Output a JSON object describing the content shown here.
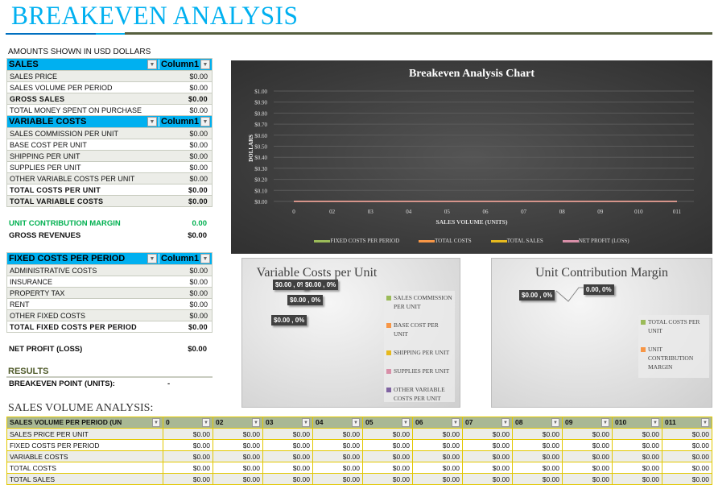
{
  "title": "BREAKEVEN ANALYSIS",
  "amounts_note": "AMOUNTS SHOWN IN USD DOLLARS",
  "column_label": "Column1",
  "sales": {
    "header": "SALES",
    "rows": [
      {
        "label": "SALES PRICE",
        "value": "$0.00",
        "bold": false
      },
      {
        "label": "SALES VOLUME PER PERIOD",
        "value": "$0.00",
        "bold": false
      },
      {
        "label": "GROSS SALES",
        "value": "$0.00",
        "bold": true
      },
      {
        "label": "TOTAL MONEY SPENT ON PURCHASE",
        "value": "$0.00",
        "bold": false
      }
    ]
  },
  "variable": {
    "header": "VARIABLE COSTS",
    "rows": [
      {
        "label": "SALES COMMISSION PER UNIT",
        "value": "$0.00",
        "bold": false
      },
      {
        "label": "BASE COST PER UNIT",
        "value": "$0.00",
        "bold": false
      },
      {
        "label": "SHIPPING PER UNIT",
        "value": "$0.00",
        "bold": false
      },
      {
        "label": "SUPPLIES PER UNIT",
        "value": "$0.00",
        "bold": false
      },
      {
        "label": "OTHER VARIABLE COSTS PER UNIT",
        "value": "$0.00",
        "bold": false
      },
      {
        "label": "TOTAL COSTS PER UNIT",
        "value": "$0.00",
        "bold": true
      },
      {
        "label": "TOTAL VARIABLE COSTS",
        "value": "$0.00",
        "bold": true
      }
    ]
  },
  "ucm": {
    "label": "UNIT CONTRIBUTION MARGIN",
    "value": "0.00"
  },
  "gross_revenues": {
    "label": "GROSS REVENUES",
    "value": "$0.00"
  },
  "fixed": {
    "header": "FIXED COSTS PER PERIOD",
    "rows": [
      {
        "label": "ADMINISTRATIVE COSTS",
        "value": "$0.00",
        "bold": false
      },
      {
        "label": "INSURANCE",
        "value": "$0.00",
        "bold": false
      },
      {
        "label": "PROPERTY TAX",
        "value": "$0.00",
        "bold": false
      },
      {
        "label": "RENT",
        "value": "$0.00",
        "bold": false
      },
      {
        "label": "OTHER FIXED COSTS",
        "value": "$0.00",
        "bold": false
      },
      {
        "label": "TOTAL FIXED COSTS PER PERIOD",
        "value": "$0.00",
        "bold": true
      }
    ]
  },
  "net_profit": {
    "label": "NET PROFIT (LOSS)",
    "value": "$0.00"
  },
  "results": {
    "header": "RESULTS",
    "breakeven_label": "BREAKEVEN POINT (UNITS):",
    "breakeven_value": "-"
  },
  "chart_data": [
    {
      "type": "line",
      "title": "Breakeven Analysis Chart",
      "xlabel": "SALES VOLUME (UNITS)",
      "ylabel": "DOLLARS",
      "categories": [
        "0",
        "02",
        "03",
        "04",
        "05",
        "06",
        "07",
        "08",
        "09",
        "010",
        "011"
      ],
      "yticks": [
        "$0.00",
        "$0.10",
        "$0.20",
        "$0.30",
        "$0.40",
        "$0.50",
        "$0.60",
        "$0.70",
        "$0.80",
        "$0.90",
        "$1.00"
      ],
      "ylim": [
        0,
        1
      ],
      "legend": "bottom",
      "series": [
        {
          "name": "FIXED COSTS PER PERIOD",
          "color": "#9bbb59",
          "values": [
            0,
            0,
            0,
            0,
            0,
            0,
            0,
            0,
            0,
            0,
            0
          ]
        },
        {
          "name": "TOTAL COSTS",
          "color": "#f79646",
          "values": [
            0,
            0,
            0,
            0,
            0,
            0,
            0,
            0,
            0,
            0,
            0
          ]
        },
        {
          "name": "TOTAL SALES",
          "color": "#e6b91e",
          "values": [
            0,
            0,
            0,
            0,
            0,
            0,
            0,
            0,
            0,
            0,
            0
          ]
        },
        {
          "name": "NET PROFIT (LOSS)",
          "color": "#d88fa8",
          "values": [
            0,
            0,
            0,
            0,
            0,
            0,
            0,
            0,
            0,
            0,
            0
          ]
        }
      ]
    },
    {
      "type": "pie",
      "title": "Variable Costs per Unit",
      "legend": "right",
      "data_labels": [
        "$0.00 , 0%",
        "$0.00 , 0%",
        "$0.00 , 0%",
        "$0.00 , 0%"
      ],
      "series": [
        {
          "name": "SALES COMMISSION PER UNIT",
          "color": "#9bbb59",
          "value": 0
        },
        {
          "name": "BASE COST PER UNIT",
          "color": "#f79646",
          "value": 0
        },
        {
          "name": "SHIPPING PER UNIT",
          "color": "#e6b91e",
          "value": 0
        },
        {
          "name": "SUPPLIES PER UNIT",
          "color": "#d88fa8",
          "value": 0
        },
        {
          "name": "OTHER VARIABLE COSTS PER UNIT",
          "color": "#8064a2",
          "value": 0
        }
      ]
    },
    {
      "type": "pie",
      "title": "Unit Contribution Margin",
      "legend": "right",
      "data_labels": [
        "$0.00 , 0%",
        "0.00, 0%"
      ],
      "series": [
        {
          "name": "TOTAL COSTS PER UNIT",
          "color": "#9bbb59",
          "value": 0
        },
        {
          "name": "UNIT CONTRIBUTION MARGIN",
          "color": "#f79646",
          "value": 0
        }
      ]
    }
  ],
  "sva": {
    "title": "SALES VOLUME ANALYSIS:",
    "header": [
      "SALES VOLUME PER PERIOD (UN",
      "0",
      "02",
      "03",
      "04",
      "05",
      "06",
      "07",
      "08",
      "09",
      "010",
      "011"
    ],
    "rows": [
      {
        "label": "SALES PRICE PER UNIT",
        "values": [
          "$0.00",
          "$0.00",
          "$0.00",
          "$0.00",
          "$0.00",
          "$0.00",
          "$0.00",
          "$0.00",
          "$0.00",
          "$0.00",
          "$0.00"
        ]
      },
      {
        "label": "FIXED COSTS PER PERIOD",
        "values": [
          "$0.00",
          "$0.00",
          "$0.00",
          "$0.00",
          "$0.00",
          "$0.00",
          "$0.00",
          "$0.00",
          "$0.00",
          "$0.00",
          "$0.00"
        ]
      },
      {
        "label": "VARIABLE COSTS",
        "values": [
          "$0.00",
          "$0.00",
          "$0.00",
          "$0.00",
          "$0.00",
          "$0.00",
          "$0.00",
          "$0.00",
          "$0.00",
          "$0.00",
          "$0.00"
        ]
      },
      {
        "label": "TOTAL COSTS",
        "values": [
          "$0.00",
          "$0.00",
          "$0.00",
          "$0.00",
          "$0.00",
          "$0.00",
          "$0.00",
          "$0.00",
          "$0.00",
          "$0.00",
          "$0.00"
        ]
      },
      {
        "label": "TOTAL SALES",
        "values": [
          "$0.00",
          "$0.00",
          "$0.00",
          "$0.00",
          "$0.00",
          "$0.00",
          "$0.00",
          "$0.00",
          "$0.00",
          "$0.00",
          "$0.00"
        ]
      }
    ]
  }
}
